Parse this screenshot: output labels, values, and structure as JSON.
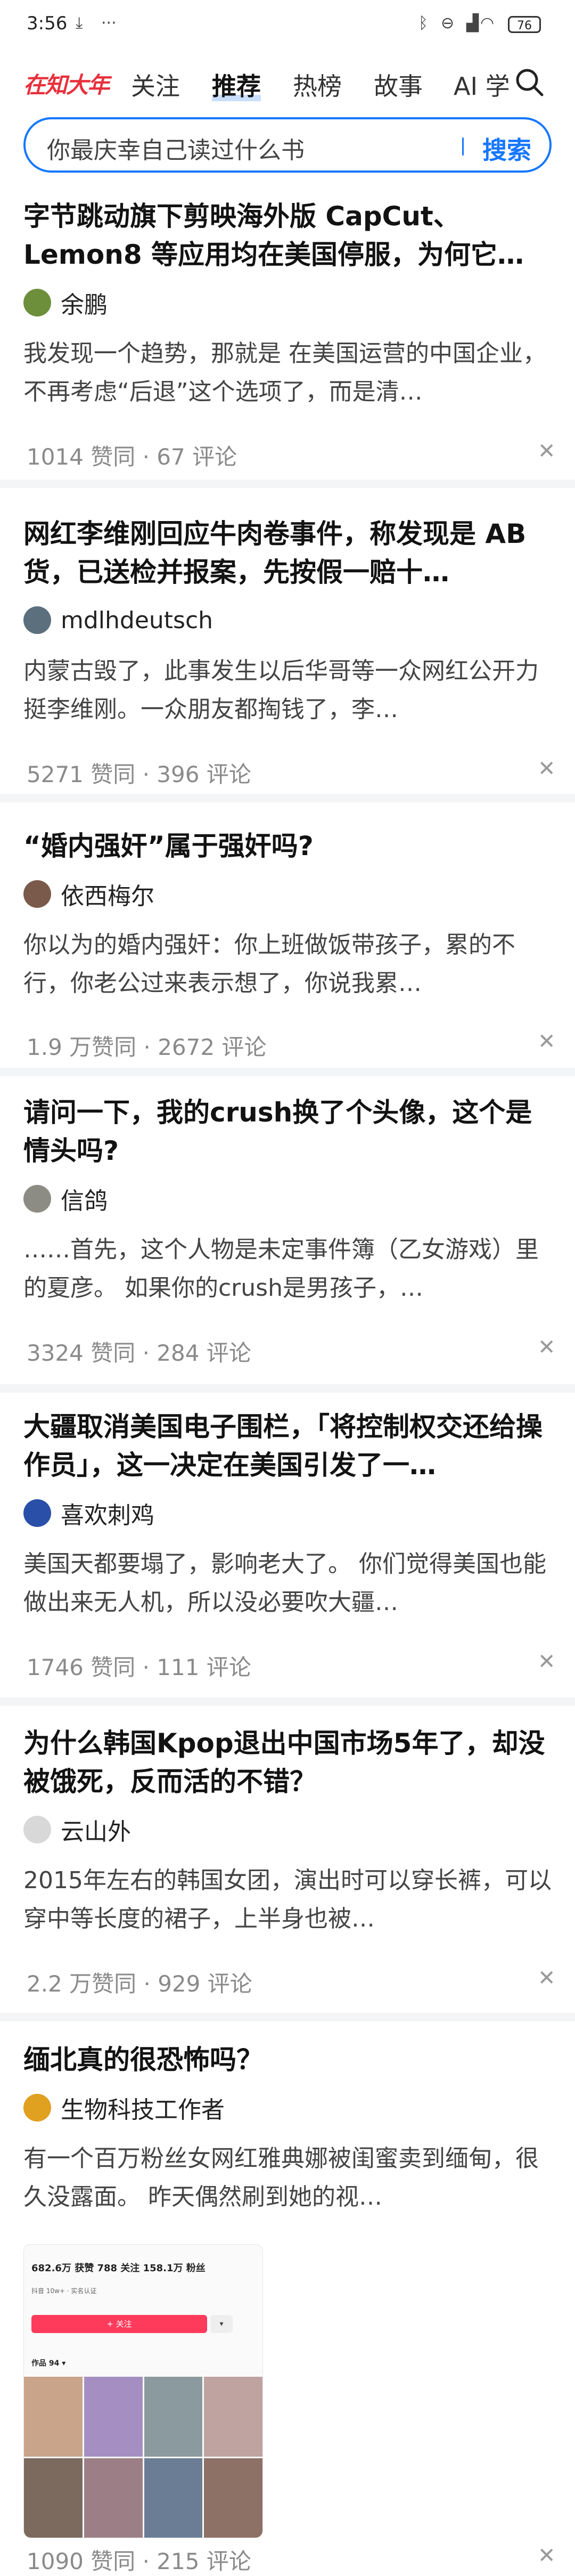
{
  "status_bar": {
    "time": "3:56",
    "battery": "76",
    "left_icons": [
      "download-icon",
      "more-dots-icon"
    ],
    "right_icons": [
      "bluetooth-icon",
      "dnd-icon",
      "signal-icon",
      "wifi-icon"
    ]
  },
  "tabs": {
    "brand": "在知大年",
    "items": [
      "关注",
      "推荐",
      "热榜",
      "故事",
      "AI 学"
    ],
    "active": "推荐"
  },
  "search": {
    "query": "你最庆幸自己读过什么书",
    "button": "搜索"
  },
  "feed": [
    {
      "title": "字节跳动旗下剪映海外版 CapCut、Lemon8 等应用均在美国停服，为何它…",
      "author": "余鹏",
      "excerpt": "我发现一个趋势，那就是 在美国运营的中国企业，不再考虑“后退”这个选项了，而是清…",
      "meta": "1014 赞同 · 67 评论",
      "avatar_color": "#6d8f3c"
    },
    {
      "title": "网红李维刚回应牛肉卷事件，称发现是 AB 货，已送检并报案，先按假一赔十…",
      "author": "mdlhdeutsch",
      "excerpt": "内蒙古毁了，此事发生以后华哥等一众网红公开力挺李维刚。一众朋友都掏钱了，李…",
      "meta": "5271 赞同 · 396 评论",
      "avatar_color": "#5b6f7d"
    },
    {
      "title": "“婚内强奸”属于强奸吗?",
      "author": "依西梅尔",
      "excerpt": "你以为的婚内强奸：你上班做饭带孩子，累的不行，你老公过来表示想了，你说我累…",
      "meta": "1.9 万赞同 · 2672 评论",
      "avatar_color": "#7a5a4a"
    },
    {
      "title": "请问一下，我的crush换了个头像，这个是情头吗?",
      "author": "信鸽",
      "excerpt": "……首先，这个人物是未定事件簿（乙女游戏）里的夏彦。 如果你的crush是男孩子，…",
      "meta": "3324 赞同 · 284 评论",
      "avatar_color": "#8c8c84"
    },
    {
      "title": "大疆取消美国电子围栏，「将控制权交还给操作员」，这一决定在美国引发了一…",
      "author": "喜欢刺鸡",
      "excerpt": "美国天都要塌了，影响老大了。 你们觉得美国也能做出来无人机，所以没必要吹大疆…",
      "meta": "1746 赞同 · 111 评论",
      "avatar_color": "#2a4fa8"
    },
    {
      "title": "为什么韩国Kpop退出中国市场5年了，却没被饿死，反而活的不错？",
      "author": "云山外",
      "excerpt": "2015年左右的韩国女团，演出时可以穿长裤，可以穿中等长度的裙子，上半身也被…",
      "meta": "2.2 万赞同 · 929 评论",
      "avatar_color": "#d8d8d8"
    },
    {
      "title": "缅北真的很恐怖吗？",
      "author": "生物科技工作者",
      "excerpt": "有一个百万粉丝女网红雅典娜被闺蜜卖到缅甸，很久没露面。 昨天偶然刷到她的视…",
      "meta": "1090 赞同 · 215 评论",
      "avatar_color": "#e0a020",
      "media": {
        "stats": "682.6万 获赞   788 关注   158.1万 粉丝",
        "subline": "抖音 10w+ · 实名认证",
        "follow": "+ 关注",
        "tab": "作品 94 ▾"
      }
    }
  ]
}
